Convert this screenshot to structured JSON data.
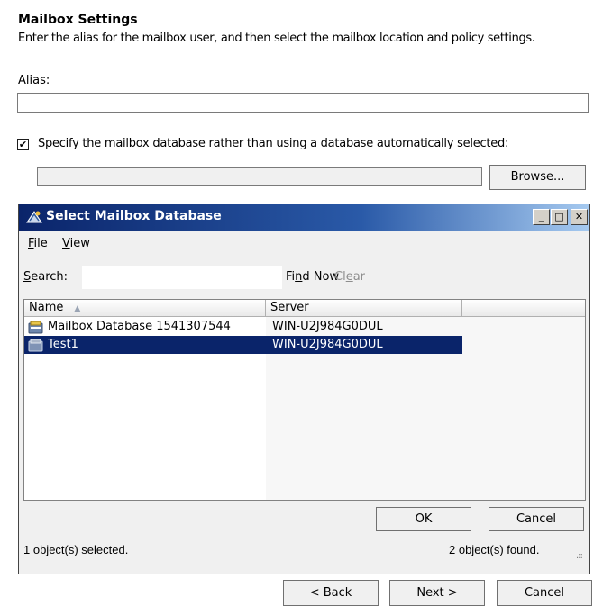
{
  "header": {
    "title": "Mailbox Settings",
    "description": "Enter the alias for the mailbox user, and then select the mailbox location and policy settings."
  },
  "alias": {
    "label": "Alias:",
    "value": ""
  },
  "database_option": {
    "checked": true,
    "check_glyph": "✔",
    "label": "Specify the mailbox database rather than using a database automatically selected:",
    "value": "",
    "browse_label": "Browse..."
  },
  "dialog": {
    "title": "Select Mailbox Database",
    "window_buttons": {
      "minimize": "_",
      "maximize": "□",
      "close": "✕"
    },
    "menu": [
      {
        "label_u": "F",
        "label_rest": "ile"
      },
      {
        "label_u": "V",
        "label_rest": "iew"
      }
    ],
    "search_label_u": "S",
    "search_label_rest": "earch:",
    "search_value": "",
    "find_now_pre": "Fi",
    "find_now_u": "n",
    "find_now_post": "d Now",
    "clear_pre": "Cl",
    "clear_u": "e",
    "clear_post": "ar",
    "columns": [
      "Name",
      "Server",
      ""
    ],
    "sort_indicator": "▲",
    "rows": [
      {
        "name": "Mailbox Database 1541307544",
        "server": "WIN-U2J984G0DUL",
        "selected": false
      },
      {
        "name": "Test1",
        "server": "WIN-U2J984G0DUL",
        "selected": true
      }
    ],
    "ok_label": "OK",
    "cancel_label": "Cancel",
    "status_left": "1 object(s) selected.",
    "status_right": "2 object(s) found.",
    "grip": ".::"
  },
  "wizard": {
    "back_label": "< Back",
    "next_label": "Next >",
    "cancel_label": "Cancel"
  },
  "colors": {
    "title_bar": "#0a246a",
    "selection": "#0a246a",
    "dialog_bg": "#f0f0f0"
  },
  "icons": {
    "dialog": "exchange-icon",
    "database": "database-icon"
  }
}
